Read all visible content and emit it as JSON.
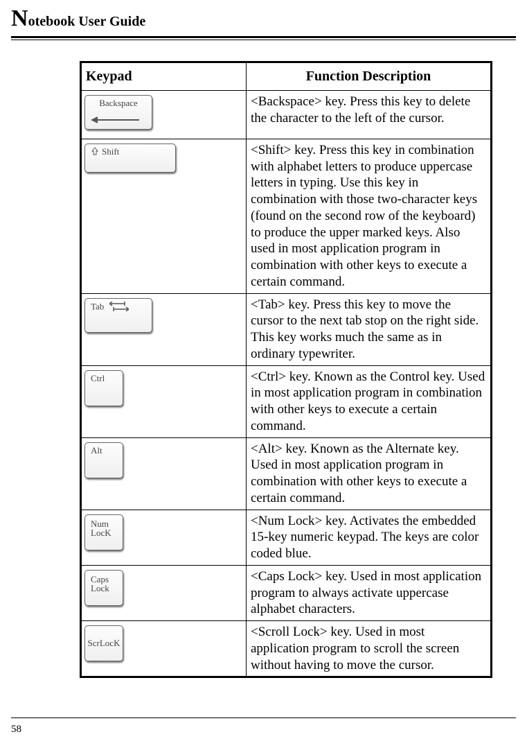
{
  "doc_title_rest": "otebook User Guide",
  "doc_title_big": "N",
  "table": {
    "header_left": "Keypad",
    "header_right": "Function Description",
    "rows": [
      {
        "key_type": "backspace",
        "key_label": "Backspace",
        "desc": "<Backspace> key. Press this key to delete the character to the left of the cursor."
      },
      {
        "key_type": "shift",
        "key_label": "Shift",
        "desc": "<Shift> key. Press this key in combination with alphabet letters to produce uppercase letters in typing. Use this key in combination with those two-character keys (found on the second row of the keyboard) to produce the upper marked keys. Also used in most application program in combination with other keys to execute a certain command."
      },
      {
        "key_type": "tab",
        "key_label": "Tab",
        "desc": "<Tab> key. Press this key to move the cursor to the next tab stop on the right side. This key works much the same as in ordinary typewriter."
      },
      {
        "key_type": "ctrl",
        "key_label": "Ctrl",
        "desc": "<Ctrl> key. Known as the Control key. Used in most application program in combination with other keys to execute a certain command."
      },
      {
        "key_type": "alt",
        "key_label": "Alt",
        "desc": "<Alt> key. Known as the Alternate key. Used in most application program in combination with other keys to execute a certain command."
      },
      {
        "key_type": "numlock",
        "key_label": "Num\nLocK",
        "desc": "<Num Lock> key. Activates the embedded 15-key numeric keypad. The keys are color coded blue."
      },
      {
        "key_type": "capslock",
        "key_label": "Caps\nLock",
        "desc": "<Caps Lock> key. Used in most application program to always activate uppercase alphabet characters."
      },
      {
        "key_type": "scrlock",
        "key_label": "ScrLocK",
        "desc": "<Scroll Lock> key. Used in most application program to scroll the screen without having to move the cursor."
      }
    ]
  },
  "page_number": "58"
}
